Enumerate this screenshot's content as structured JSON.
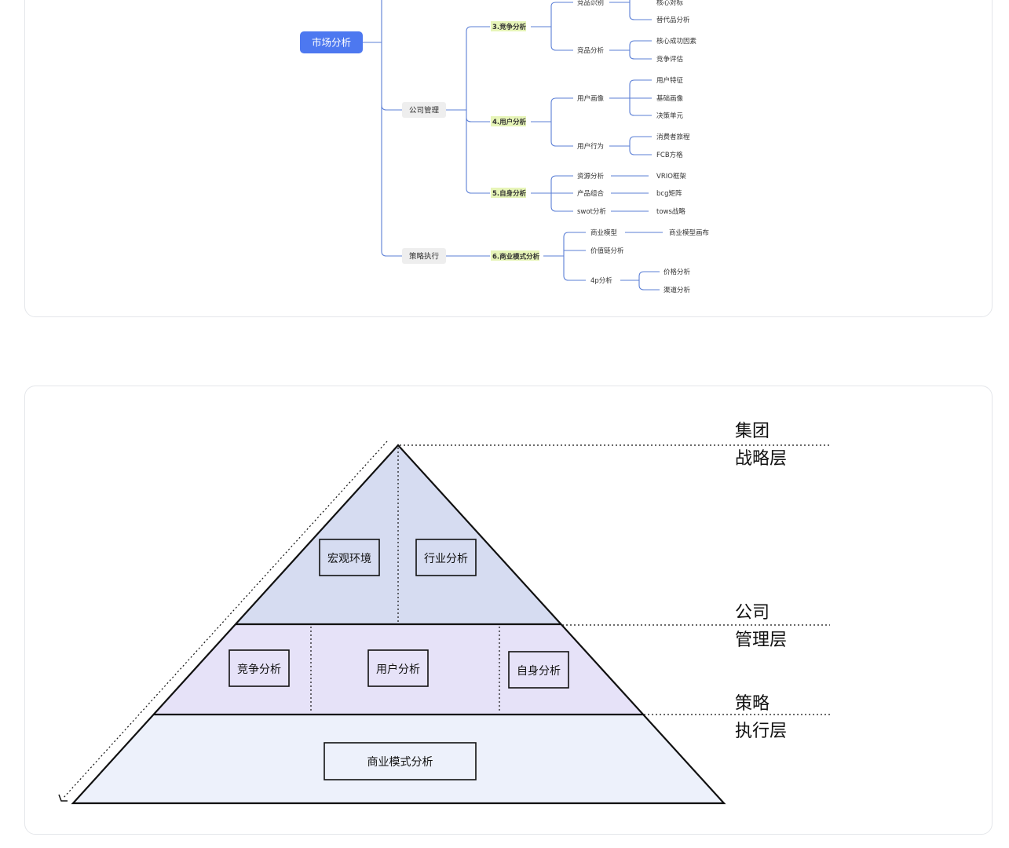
{
  "mindmap": {
    "root": "市场分析",
    "branches": [
      {
        "label": "公司管理"
      },
      {
        "label": "策略执行"
      }
    ],
    "sections": [
      {
        "label": "3.竞争分析"
      },
      {
        "label": "4.用户分析"
      },
      {
        "label": "5.自身分析"
      },
      {
        "label": "6.商业模式分析"
      }
    ],
    "nodes": {
      "jingpin_shibie": "竞品识别",
      "jingpin_fenxi": "竞品分析",
      "hexin_duibiao": "核心对标",
      "tidaipin": "替代品分析",
      "hexin_chenggong": "核心成功因素",
      "jingzheng_pinggu": "竞争评估",
      "yonghu_huaxiang": "用户画像",
      "yonghu_tezheng": "用户特征",
      "jichu_huaxiang": "基础画像",
      "juece_danyuan": "决策单元",
      "yonghu_xingwei": "用户行为",
      "xiaofeizhe_lvcheng": "消费者旅程",
      "fcb": "FCB方格",
      "ziyuan_fenxi": "资源分析",
      "vrio": "VRIO框架",
      "chanpin_zuhe": "产品组合",
      "bcg": "bcg矩阵",
      "swot": "swot分析",
      "tows": "tows战略",
      "shangye_moxing": "商业模型",
      "shangye_huabu": "商业模型画布",
      "jiazhilian": "价值链分析",
      "fourp": "4p分析",
      "jiage": "价格分析",
      "qudao": "渠道分析"
    }
  },
  "pyramid": {
    "boxes": {
      "hongguan": "宏观环境",
      "hangye": "行业分析",
      "jingzheng": "竞争分析",
      "yonghu": "用户分析",
      "zishen": "自身分析",
      "shangye": "商业模式分析"
    },
    "layers": [
      {
        "line1": "集团",
        "line2": "战略层"
      },
      {
        "line1": "公司",
        "line2": "管理层"
      },
      {
        "line1": "策略",
        "line2": "执行层"
      }
    ],
    "colors": {
      "top": "#d6dcf1",
      "middle": "#e6e2f8",
      "bottom": "#edf1fb"
    }
  },
  "colors": {
    "accent": "#4d78f0",
    "connector": "#5b7fd6",
    "highlight": "#e7f5b8",
    "branch_bg": "#eeeeee"
  }
}
